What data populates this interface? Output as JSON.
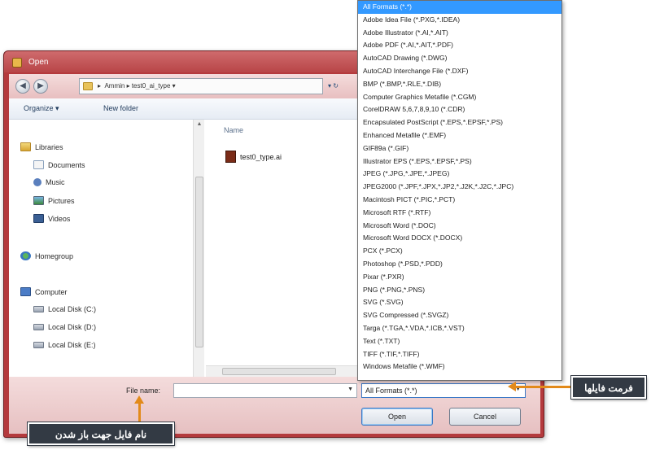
{
  "window": {
    "title": "Open"
  },
  "address": {
    "back_icon": "back-arrow-icon",
    "forward_icon": "forward-arrow-icon",
    "path": "▸  Ammin ▸ test0_ai_type ▾",
    "refresh": "▾ ↻"
  },
  "toolbar": {
    "organize": "Organize ▾",
    "new_folder": "New folder"
  },
  "nav": {
    "libraries": "Libraries",
    "documents": "Documents",
    "music": "Music",
    "pictures": "Pictures",
    "videos": "Videos",
    "homegroup": "Homegroup",
    "computer": "Computer",
    "disk_c": "Local Disk (C:)",
    "disk_d": "Local Disk (D:)",
    "disk_e": "Local Disk (E:)"
  },
  "files": {
    "column_name": "Name",
    "items": [
      "test0_type.ai"
    ]
  },
  "bottom": {
    "file_name_label": "File name:",
    "file_format_selected": "All Formats (*.*)",
    "open_label": "Open",
    "cancel_label": "Cancel"
  },
  "dropdown": {
    "items": [
      "All Formats (*.*)",
      "Adobe Idea File (*.PXG,*.IDEA)",
      "Adobe Illustrator (*.AI,*.AIT)",
      "Adobe PDF (*.AI,*.AIT,*.PDF)",
      "AutoCAD Drawing (*.DWG)",
      "AutoCAD Interchange File (*.DXF)",
      "BMP (*.BMP,*.RLE,*.DIB)",
      "Computer Graphics Metafile (*.CGM)",
      "CorelDRAW 5,6,7,8,9,10 (*.CDR)",
      "Encapsulated PostScript (*.EPS,*.EPSF,*.PS)",
      "Enhanced Metafile (*.EMF)",
      "GIF89a (*.GIF)",
      "Illustrator EPS (*.EPS,*.EPSF,*.PS)",
      "JPEG (*.JPG,*.JPE,*.JPEG)",
      "JPEG2000 (*.JPF,*.JPX,*.JP2,*.J2K,*.J2C,*.JPC)",
      "Macintosh PICT (*.PIC,*.PCT)",
      "Microsoft RTF (*.RTF)",
      "Microsoft Word (*.DOC)",
      "Microsoft Word DOCX (*.DOCX)",
      "PCX (*.PCX)",
      "Photoshop (*.PSD,*.PDD)",
      "Pixar (*.PXR)",
      "PNG (*.PNG,*.PNS)",
      "SVG (*.SVG)",
      "SVG Compressed (*.SVGZ)",
      "Targa (*.TGA,*.VDA,*.ICB,*.VST)",
      "Text (*.TXT)",
      "TIFF (*.TIF,*.TIFF)",
      "Windows Metafile (*.WMF)"
    ]
  },
  "callouts": {
    "file_format": "فرمت فایلها",
    "file_name": "نام فایل جهت باز شدن"
  },
  "colors": {
    "frame": "#b43a3d",
    "selection": "#3399ff",
    "callout_bg": "#333a44",
    "arrow": "#e28a1a"
  }
}
